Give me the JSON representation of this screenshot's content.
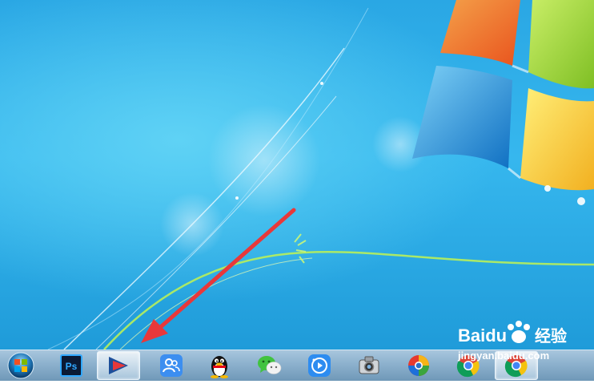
{
  "desktop": {
    "wallpaper": "Windows 7 default"
  },
  "taskbar": {
    "start_icon": "windows-orb-icon",
    "pinned": [
      {
        "icon": "photoshop-icon",
        "label": "Ps",
        "active": false
      },
      {
        "icon": "red-arrow-app-icon",
        "active": true
      },
      {
        "icon": "contacts-icon",
        "active": false
      },
      {
        "icon": "qq-penguin-icon",
        "active": false
      },
      {
        "icon": "wechat-icon",
        "active": false
      },
      {
        "icon": "media-player-icon",
        "active": false
      },
      {
        "icon": "camera-app-icon",
        "active": false
      },
      {
        "icon": "firefox-style-browser-icon",
        "active": false
      },
      {
        "icon": "chrome-icon",
        "active": false
      },
      {
        "icon": "chrome-icon",
        "active": true
      }
    ]
  },
  "watermark": {
    "brand": "Baidu",
    "service": "经验",
    "url": "jingyan.baidu.com"
  },
  "colors": {
    "accent": "#e8383a",
    "taskbar": "#8fb3cf",
    "desktop": "#2aa7e4"
  }
}
